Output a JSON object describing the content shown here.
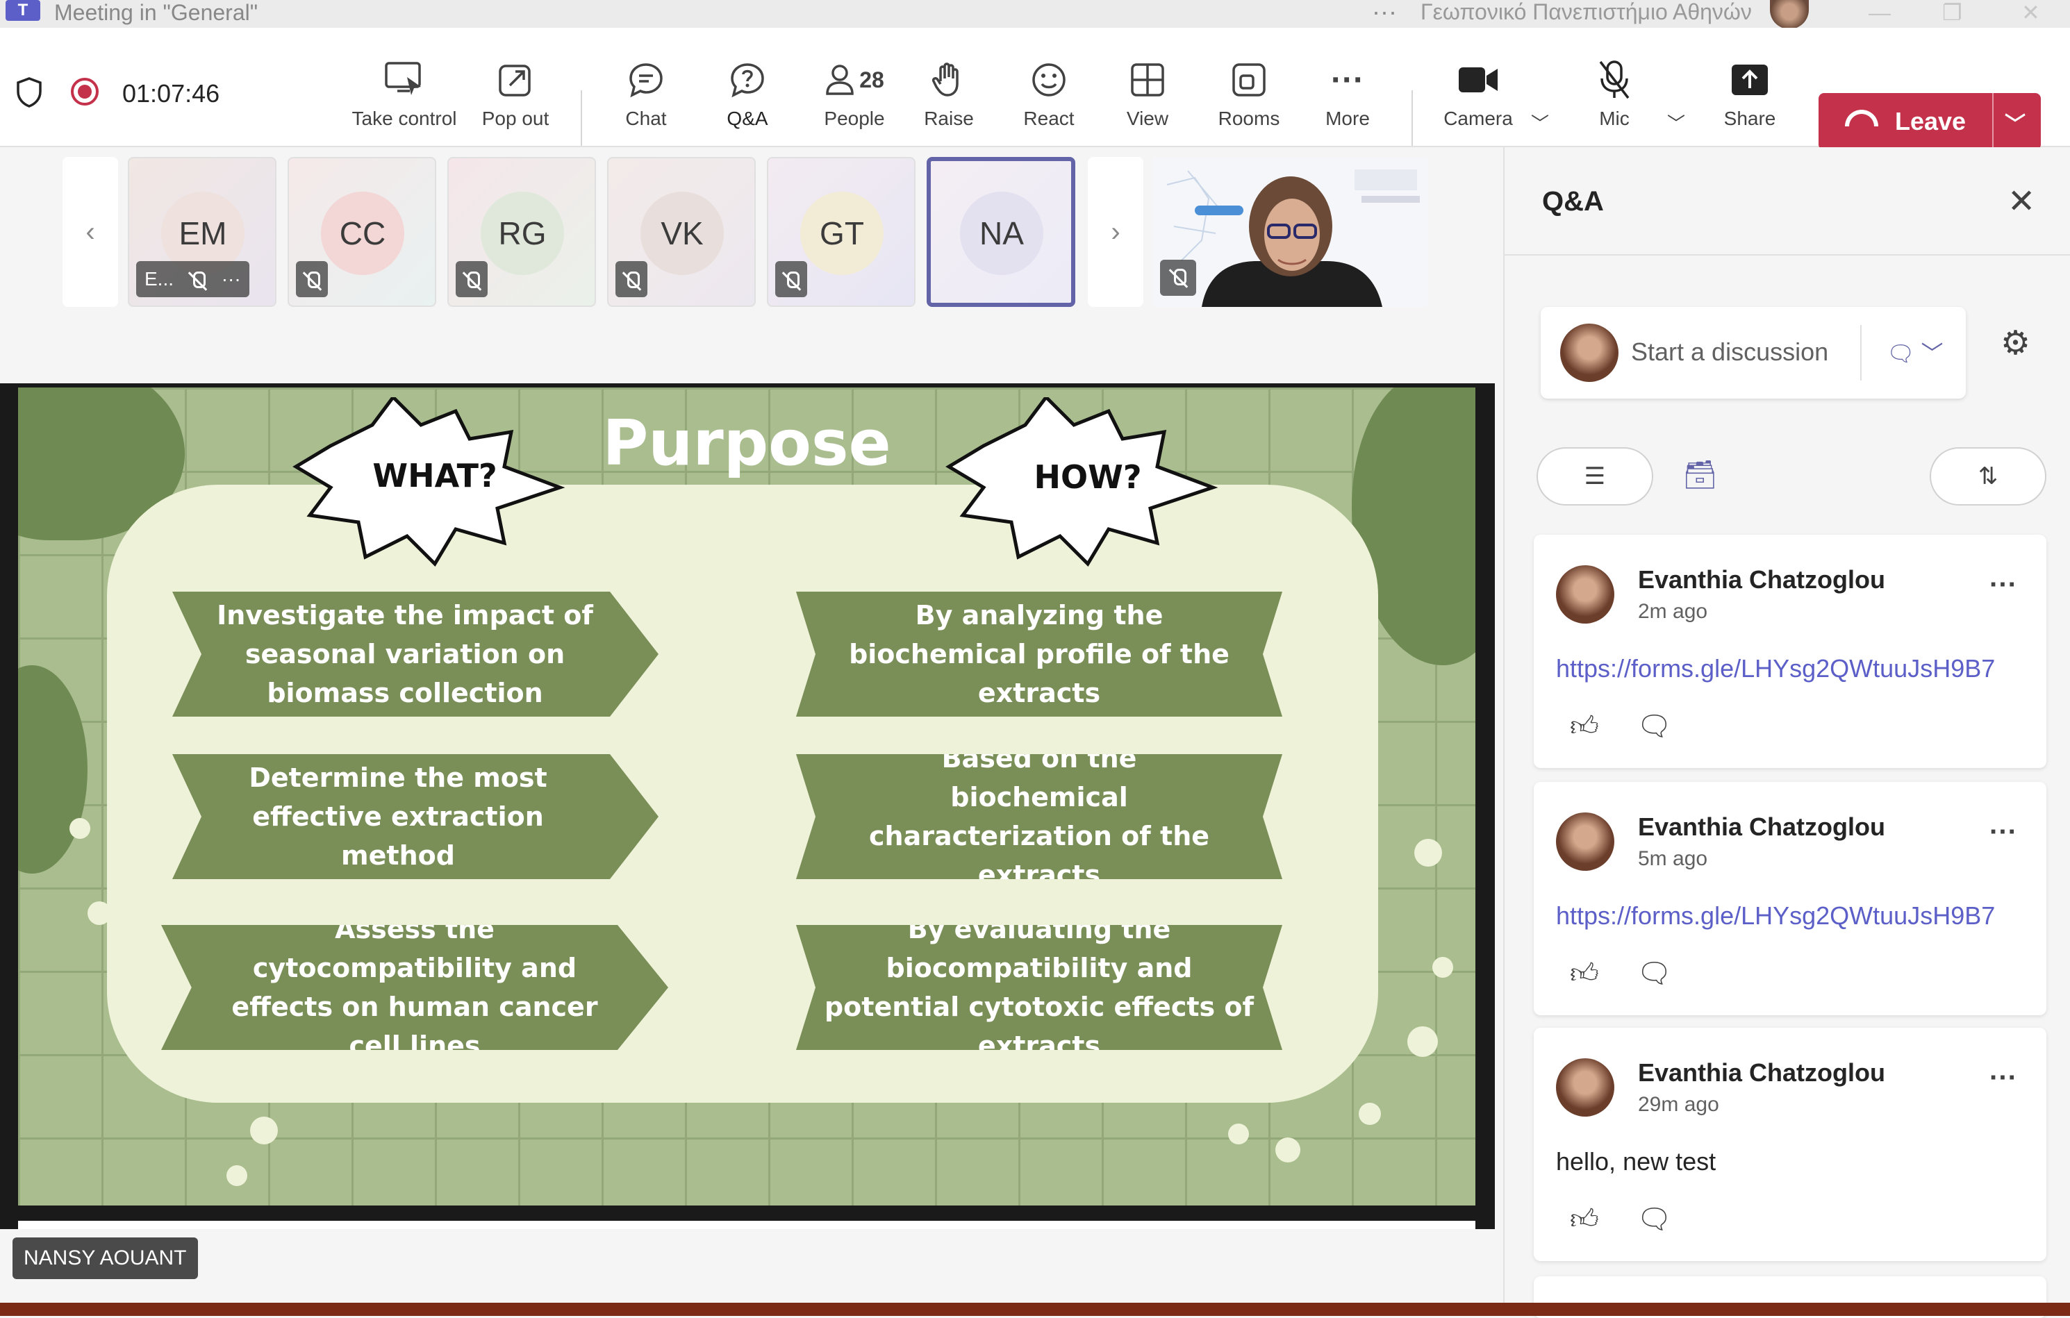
{
  "window": {
    "app_icon": "teams-logo-icon",
    "title": "Meeting in \"General\"",
    "org_name": "Γεωπονικό Πανεπιστήμιο Αθηνών",
    "controls": [
      "minimize-icon",
      "maximize-icon",
      "close-icon"
    ]
  },
  "toolbar": {
    "timer": "01:07:46",
    "buttons": [
      {
        "id": "take-control",
        "label": "Take control",
        "icon": "screen-pointer-icon"
      },
      {
        "id": "pop-out",
        "label": "Pop out",
        "icon": "pop-out-icon"
      },
      {
        "id": "chat",
        "label": "Chat",
        "icon": "chat-bubble-icon"
      },
      {
        "id": "qa",
        "label": "Q&A",
        "icon": "question-bubble-icon",
        "active": true
      },
      {
        "id": "people",
        "label": "People",
        "icon": "person-icon",
        "count": "28"
      },
      {
        "id": "raise",
        "label": "Raise",
        "icon": "hand-icon"
      },
      {
        "id": "react",
        "label": "React",
        "icon": "smiley-icon"
      },
      {
        "id": "view",
        "label": "View",
        "icon": "grid-icon"
      },
      {
        "id": "rooms",
        "label": "Rooms",
        "icon": "rooms-icon"
      },
      {
        "id": "more",
        "label": "More",
        "icon": "more-dots-icon"
      },
      {
        "id": "camera",
        "label": "Camera",
        "icon": "camera-icon"
      },
      {
        "id": "mic",
        "label": "Mic",
        "icon": "mic-off-icon"
      },
      {
        "id": "share",
        "label": "Share",
        "icon": "share-upload-icon"
      }
    ],
    "leave_label": "Leave"
  },
  "participants": [
    {
      "initials": "EM",
      "badge_text": "E...",
      "color": "#efe1dd"
    },
    {
      "initials": "CC",
      "color": "#f3d6d6"
    },
    {
      "initials": "RG",
      "color": "#dfe8da"
    },
    {
      "initials": "VK",
      "color": "#e8dfdc"
    },
    {
      "initials": "GT",
      "color": "#f2ecd6"
    },
    {
      "initials": "NA",
      "color": "#e3e1f0",
      "selected": true
    }
  ],
  "slide": {
    "title": "Purpose",
    "what_label": "WHAT?",
    "how_label": "HOW?",
    "what_items": [
      "Investigate the impact of seasonal variation on biomass collection",
      "Determine the most effective extraction method",
      "Assess the cytocompatibility and effects on human cancer cell lines"
    ],
    "how_items": [
      "By analyzing the biochemical profile of the extracts",
      "Based on the biochemical characterization of the extracts",
      "By evaluating the biocompatibility and potential cytotoxic effects of extracts"
    ]
  },
  "presenter_name": "NANSY AOUANT",
  "qa": {
    "title": "Q&A",
    "discussion_placeholder": "Start a discussion",
    "posts": [
      {
        "author": "Evanthia Chatzoglou",
        "time": "2m ago",
        "body": "https://forms.gle/LHYsg2QWtuuJsH9B7",
        "is_link": true
      },
      {
        "author": "Evanthia Chatzoglou",
        "time": "5m ago",
        "body": "https://forms.gle/LHYsg2QWtuuJsH9B7",
        "is_link": true
      },
      {
        "author": "Evanthia Chatzoglou",
        "time": "29m ago",
        "body": "hello, new test",
        "is_link": false
      }
    ]
  },
  "colors": {
    "accent": "#5b5fc7",
    "leave": "#c4314b",
    "slide_green": "#7a8e58"
  }
}
